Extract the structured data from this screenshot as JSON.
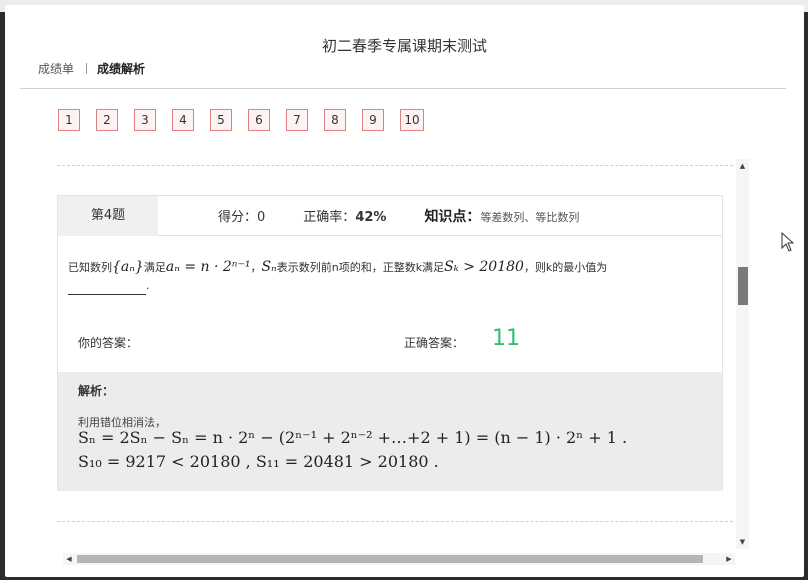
{
  "modal": {
    "title": "初二春季专属课期末测试",
    "tabs": [
      "成绩单",
      "成绩解析"
    ],
    "active_tab": "成绩解析"
  },
  "question_nav": [
    "1",
    "2",
    "3",
    "4",
    "5",
    "6",
    "7",
    "8",
    "9",
    "10"
  ],
  "question": {
    "number_label": "第4题",
    "score_label": "得分：",
    "score_value": "0",
    "accuracy_label": "正确率：",
    "accuracy_value": "42%",
    "knowledge_label": "知识点：",
    "knowledge_value": "等差数列、等比数列",
    "stem": {
      "t1": "已知数列",
      "m1": "{aₙ}",
      "t2": "满足",
      "m2": "aₙ = n · 2ⁿ⁻¹",
      "t3": "，",
      "m3": "Sₙ",
      "t4": "表示数列前n项的和，正整数k满足",
      "m4": "Sₖ > 20180",
      "t5": "，则k的最小值为",
      "t6": "."
    },
    "your_answer_label": "你的答案：",
    "correct_answer_label": "正确答案：",
    "correct_answer_value": "11",
    "analysis_title": "解析：",
    "analysis_intro": "利用错位相消法，",
    "analysis_eq1": "Sₙ = 2Sₙ − Sₙ = n · 2ⁿ − (2ⁿ⁻¹ + 2ⁿ⁻² +…+2 + 1) = (n − 1) · 2ⁿ + 1   .",
    "analysis_eq2": "S₁₀ = 9217 < 20180  , S₁₁ = 20481 > 20180  ."
  },
  "colors": {
    "accent_green": "#2fbf71",
    "nav_border": "#e08080",
    "analysis_bg": "#ececec"
  }
}
